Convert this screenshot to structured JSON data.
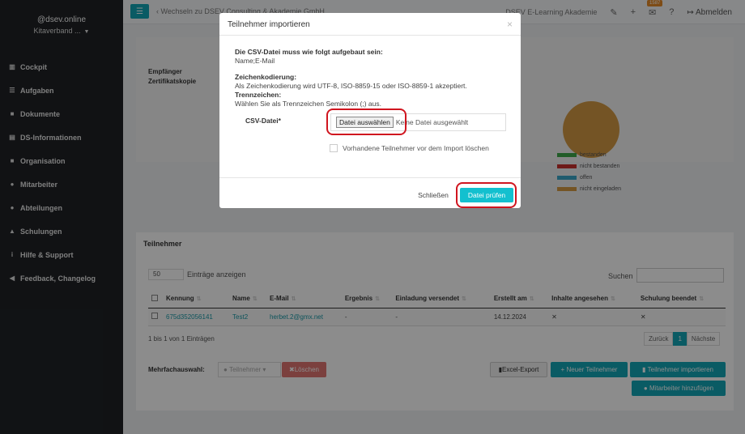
{
  "sidebar": {
    "user": "@dsev.online",
    "org": "Kitaverband ...",
    "items": [
      {
        "label": "Cockpit",
        "icon": "chart-icon"
      },
      {
        "label": "Aufgaben",
        "icon": "list-icon"
      },
      {
        "label": "Dokumente",
        "icon": "folder-icon"
      },
      {
        "label": "DS-Informationen",
        "icon": "book-icon"
      },
      {
        "label": "Organisation",
        "icon": "folder-icon"
      },
      {
        "label": "Mitarbeiter",
        "icon": "users-icon"
      },
      {
        "label": "Abteilungen",
        "icon": "users-icon"
      },
      {
        "label": "Schulungen",
        "icon": "school-icon"
      },
      {
        "label": "Hilfe & Support",
        "icon": "info-icon"
      },
      {
        "label": "Feedback, Changelog",
        "icon": "megaphone-icon"
      }
    ]
  },
  "topbar": {
    "back": "Wechseln zu DSEV Consulting & Akademie GmbH",
    "akademie": "DSEV E-Learning Akademie",
    "badge": "1587",
    "logout": "Abmelden"
  },
  "background": {
    "empf": "Empfänger",
    "zert": "Zertifikatskopie",
    "legend": [
      {
        "label": "bestanden",
        "color": "#3fa84a"
      },
      {
        "label": "nicht bestanden",
        "color": "#c9302c"
      },
      {
        "label": "offen",
        "color": "#3aa7c9"
      },
      {
        "label": "nicht eingeladen",
        "color": "#d49a44"
      }
    ],
    "pie_color": "#d49a44"
  },
  "participants": {
    "title": "Teilnehmer",
    "length_value": "50",
    "length_label": "Einträge anzeigen",
    "search_label": "Suchen",
    "columns": [
      "Kennung",
      "Name",
      "E-Mail",
      "Ergebnis",
      "Einladung versendet",
      "Erstellt am",
      "Inhalte angesehen",
      "Schulung beendet"
    ],
    "rows": [
      [
        "675d352056141",
        "Test2",
        "herbet.2@gmx.net",
        "-",
        "-",
        "14.12.2024",
        "✕",
        "✕"
      ]
    ],
    "info": "1 bis 1 von 1 Einträgen",
    "prev": "Zurück",
    "page": "1",
    "next": "Nächste",
    "multi_label": "Mehrfachauswahl:",
    "multi_dropdown": "Teilnehmer",
    "delete": "Löschen",
    "excel": "Excel-Export",
    "new": "Neuer Teilnehmer",
    "import": "Teilnehmer importieren",
    "add_staff": "Mitarbeiter hinzufügen"
  },
  "modal": {
    "title": "Teilnehmer importieren",
    "close_x": "×",
    "h1": "Die CSV-Datei muss wie folgt aufgebaut sein:",
    "t1": "Name;E-Mail",
    "h2": "Zeichenkodierung:",
    "t2": "Als Zeichenkodierung wird UTF-8, ISO-8859-15 oder ISO-8859-1 akzeptiert.",
    "h3": "Trennzeichen:",
    "t3": "Wählen Sie als Trennzeichen Semikolon (;) aus.",
    "csv_label": "CSV-Datei*",
    "file_button": "Datei auswählen",
    "file_none": "Keine Datei ausgewählt",
    "checkbox_label": "Vorhandene Teilnehmer vor dem Import löschen",
    "close_btn": "Schließen",
    "check_btn": "Datei prüfen"
  }
}
